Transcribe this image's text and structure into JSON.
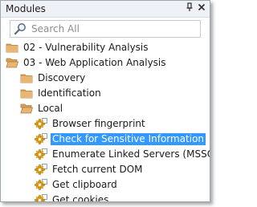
{
  "panel": {
    "title": "Modules",
    "pin_glyph": "⫫",
    "close_glyph": "✕"
  },
  "search": {
    "placeholder": "Search All",
    "value": ""
  },
  "tree": {
    "items": [
      {
        "label": "02 - Vulnerability Analysis",
        "icon": "folder-icon",
        "level": 0,
        "selected": false
      },
      {
        "label": "03 - Web Application Analysis",
        "icon": "folder-open-icon",
        "level": 0,
        "selected": false
      },
      {
        "label": "Discovery",
        "icon": "folder-icon",
        "level": 1,
        "selected": false
      },
      {
        "label": "Identification",
        "icon": "folder-icon",
        "level": 1,
        "selected": false
      },
      {
        "label": "Local",
        "icon": "folder-open-icon",
        "level": 1,
        "selected": false
      },
      {
        "label": "Browser fingerprint",
        "icon": "module-gear-icon",
        "level": 2,
        "selected": false
      },
      {
        "label": "Check for Sensitive Information",
        "icon": "module-gear-icon",
        "level": 2,
        "selected": true
      },
      {
        "label": "Enumerate Linked Servers (MSSQL)",
        "icon": "module-gear-icon",
        "level": 2,
        "selected": false
      },
      {
        "label": "Fetch current DOM",
        "icon": "module-gear-icon",
        "level": 2,
        "selected": false
      },
      {
        "label": "Get clipboard",
        "icon": "module-gear-icon",
        "level": 2,
        "selected": false
      },
      {
        "label": "Get cookies",
        "icon": "module-gear-icon",
        "level": 2,
        "selected": false
      }
    ]
  },
  "colors": {
    "selection": "#3399ff",
    "folder": "#d9a05b",
    "gear": "#e8a317"
  }
}
